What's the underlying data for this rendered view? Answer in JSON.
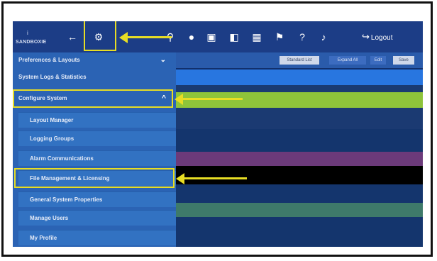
{
  "brand": {
    "mark": "i",
    "name": "SANDBOXIE"
  },
  "toolbar": {
    "icons": [
      "back-arrow-icon",
      "gear-icon",
      "search-icon",
      "circle-icon",
      "calendar-icon",
      "panel-icon",
      "grid-icon",
      "tag-icon",
      "help-icon",
      "bell-icon"
    ],
    "logout_label": "Logout"
  },
  "sidebar": {
    "items": [
      {
        "label": "Preferences & Layouts",
        "chevron": "⌄"
      },
      {
        "label": "System Logs & Statistics"
      },
      {
        "label": "Configure System",
        "chevron": "^"
      },
      {
        "label": "Layout Manager"
      },
      {
        "label": "Logging Groups"
      },
      {
        "label": "Alarm Communications"
      },
      {
        "label": "File Management & Licensing"
      },
      {
        "label": "General System Properties"
      },
      {
        "label": "Manage Users"
      },
      {
        "label": "My Profile"
      }
    ]
  },
  "content": {
    "buttons": [
      "Standard List",
      "Expand All",
      "Edit",
      "Save"
    ],
    "bands": [
      {
        "color": "#2876e0"
      },
      {
        "color": "#1a3b72"
      },
      {
        "color": "#8ec43a"
      },
      {
        "color": "#1b3a72"
      },
      {
        "color": "#14356d"
      },
      {
        "color": "#6c3a7a"
      },
      {
        "color": "#000000"
      },
      {
        "color": "#14356d"
      },
      {
        "color": "#3e7a6a"
      },
      {
        "color": "#14356d"
      }
    ]
  },
  "colors": {
    "highlight": "#e7dd24",
    "topbar": "#1c3d86",
    "sidebar": "#2b63b4"
  }
}
